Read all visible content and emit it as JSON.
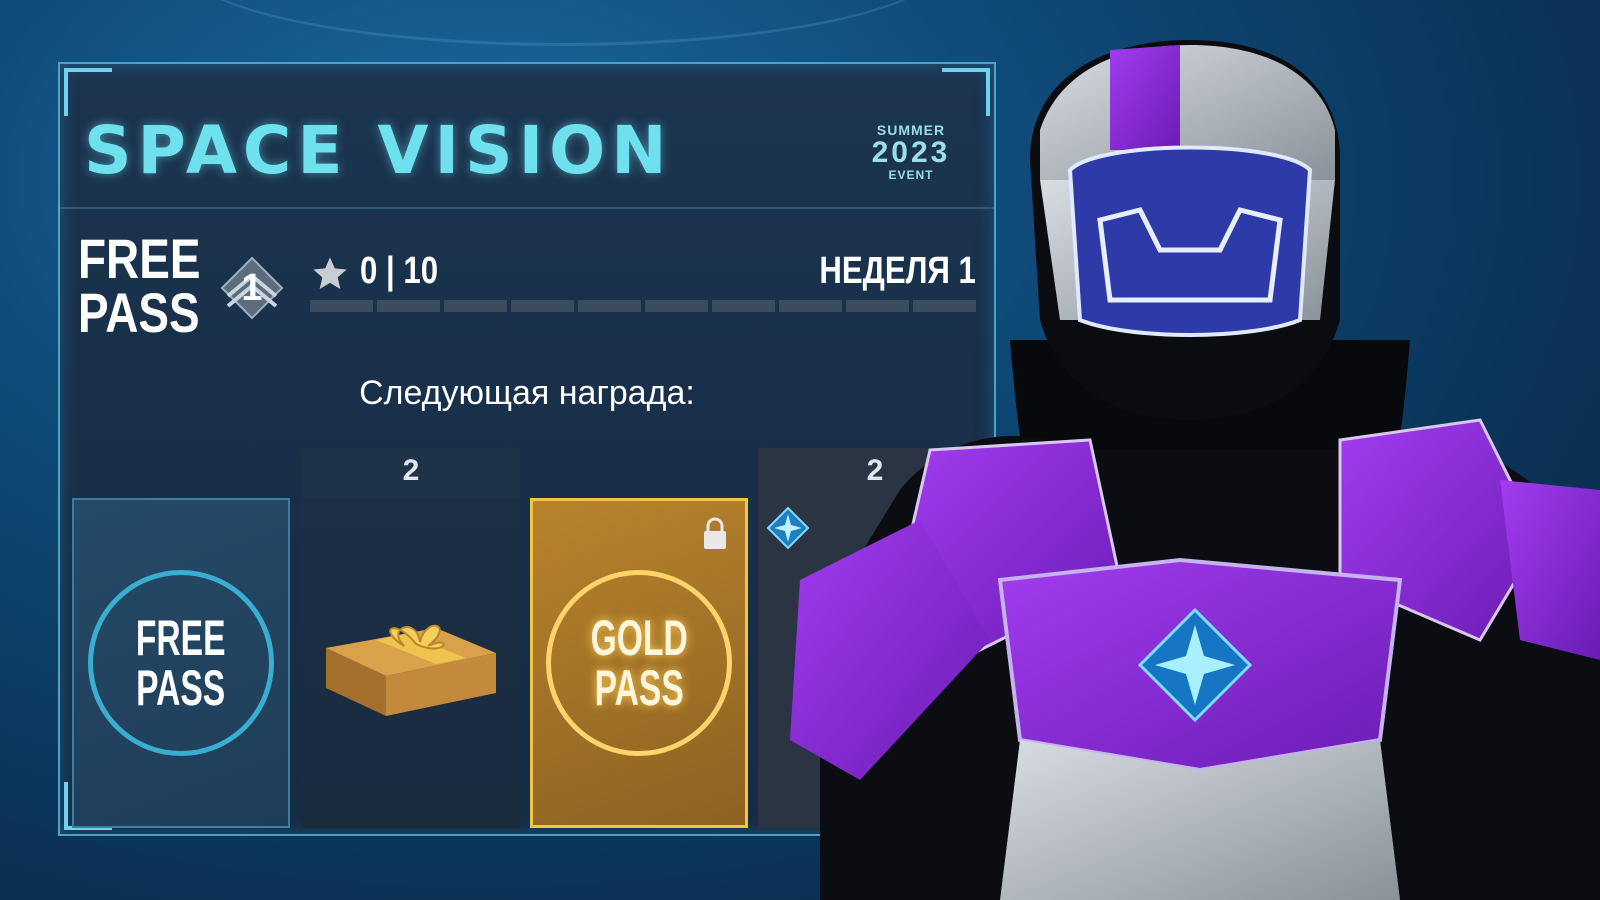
{
  "event": {
    "title": "SPACE VISION",
    "badge": {
      "season": "SUMMER",
      "year": "2023",
      "label": "EVENT"
    }
  },
  "pass": {
    "label_line1": "FREE",
    "label_line2": "PASS",
    "level": "1",
    "progress_text": "0 | 10",
    "progress_value": 0,
    "progress_max": 10,
    "week": "НЕДЕЛЯ 1"
  },
  "next_reward_label": "Следующая награда:",
  "rewards": [
    {
      "type": "free-pass",
      "count": "",
      "line1": "FREE",
      "line2": "PASS"
    },
    {
      "type": "gift-box",
      "count": "2"
    },
    {
      "type": "gold-pass",
      "count": "",
      "line1": "GOLD",
      "line2": "PASS",
      "locked": true
    },
    {
      "type": "partial-item",
      "count": "2"
    }
  ],
  "icons": {
    "star": "star-icon",
    "lock": "lock-icon",
    "level": "chevron-rank-icon",
    "diamond": "diamond-star-icon"
  },
  "colors": {
    "accent": "#6fe0ee",
    "gold": "#f2c542",
    "purple_armor": "#8a2ad8"
  }
}
